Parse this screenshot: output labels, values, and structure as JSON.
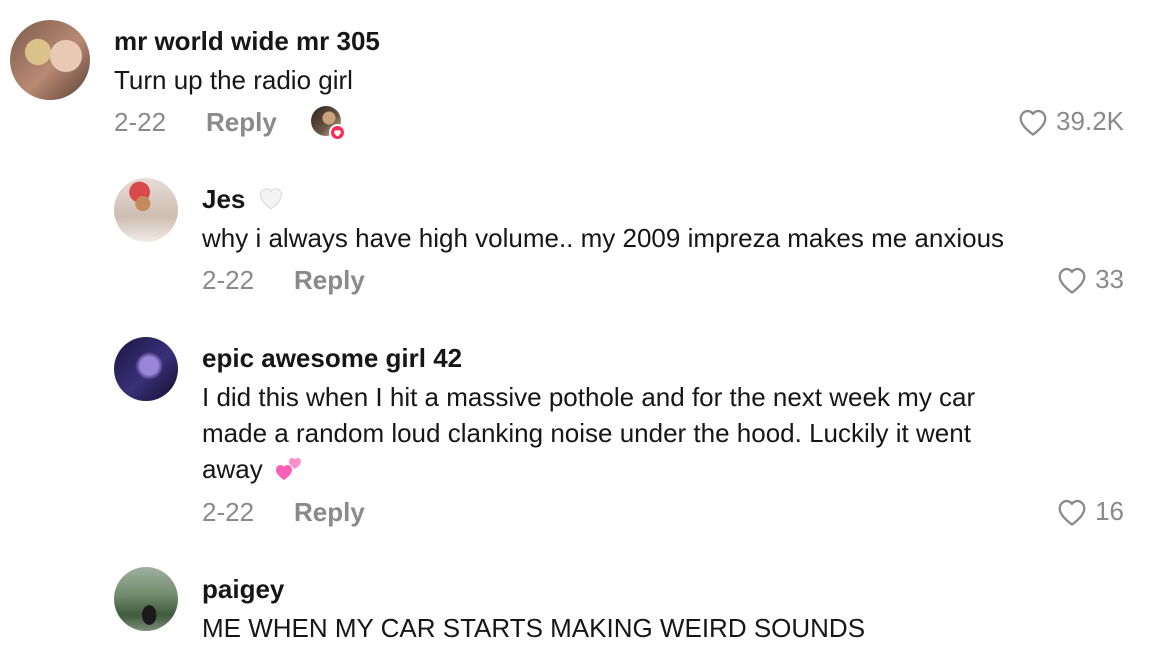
{
  "comments": [
    {
      "username": "mr world wide mr 305",
      "text": "Turn up the radio girl",
      "date": "2-22",
      "reply_label": "Reply",
      "likes": "39.2K",
      "creator_liked": true
    }
  ],
  "replies": [
    {
      "username": "Jes",
      "badge_icon": "white-heart-icon",
      "text": "why i always have high volume.. my 2009 impreza makes me anxious",
      "date": "2-22",
      "reply_label": "Reply",
      "likes": "33"
    },
    {
      "username": "epic awesome girl 42",
      "text_line1": "I did this when I hit a massive pothole and for the next week my car",
      "text_line2": "made a random loud clanking noise under the hood. Luckily it went",
      "text_line3": "away",
      "emoji_icon": "two-hearts-icon",
      "date": "2-22",
      "reply_label": "Reply",
      "likes": "16"
    },
    {
      "username": "paigey",
      "text": "ME WHEN MY CAR STARTS MAKING WEIRD SOUNDS"
    }
  ],
  "colors": {
    "text": "#161616",
    "meta": "#8a8a8a",
    "heart_outline": "#8a8a8a",
    "liked_badge": "#fe2c55"
  }
}
